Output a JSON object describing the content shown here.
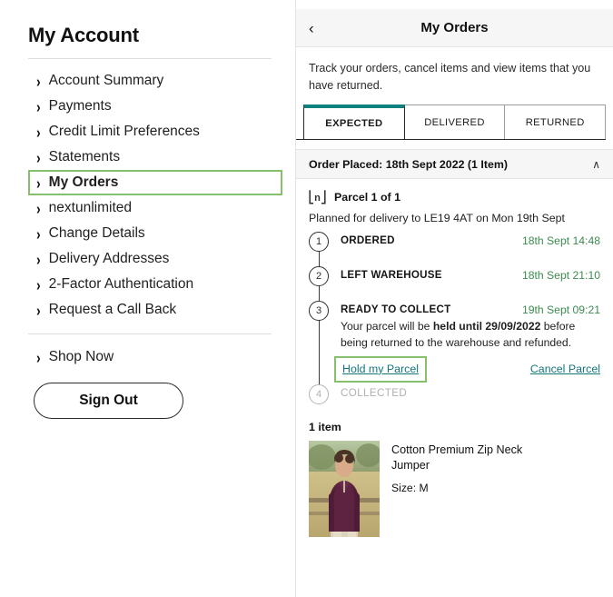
{
  "sidebar": {
    "title": "My Account",
    "items": [
      {
        "label": "Account Summary",
        "active": false
      },
      {
        "label": "Payments",
        "active": false
      },
      {
        "label": "Credit Limit Preferences",
        "active": false
      },
      {
        "label": "Statements",
        "active": false
      },
      {
        "label": "My Orders",
        "active": true
      },
      {
        "label": "nextunlimited",
        "active": false
      },
      {
        "label": "Change Details",
        "active": false
      },
      {
        "label": "Delivery Addresses",
        "active": false
      },
      {
        "label": "2-Factor Authentication",
        "active": false
      },
      {
        "label": "Request a Call Back",
        "active": false
      }
    ],
    "shop_now": "Shop Now",
    "sign_out": "Sign Out",
    "chevron": "›"
  },
  "panel": {
    "back_icon": "‹",
    "title": "My Orders",
    "intro": "Track your orders, cancel items and view items that you have returned.",
    "tabs": [
      {
        "label": "EXPECTED",
        "active": true
      },
      {
        "label": "DELIVERED",
        "active": false
      },
      {
        "label": "RETURNED",
        "active": false
      }
    ],
    "order_bar": {
      "label": "Order Placed: 18th Sept 2022 (1 Item)",
      "caret": "∧"
    },
    "parcel": {
      "logo_letter": "n",
      "label": "Parcel 1 of 1",
      "planned": "Planned for delivery to LE19 4AT on Mon 19th Sept"
    },
    "timeline": [
      {
        "num": "1",
        "name": "ORDERED",
        "date": "18th Sept 14:48",
        "muted": false
      },
      {
        "num": "2",
        "name": "LEFT WAREHOUSE",
        "date": "18th Sept 21:10",
        "muted": false
      },
      {
        "num": "3",
        "name": "READY TO COLLECT",
        "date": "19th Sept 09:21",
        "muted": false
      },
      {
        "num": "4",
        "name": "COLLECTED",
        "date": "",
        "muted": true
      }
    ],
    "note": {
      "prefix": "Your parcel will be ",
      "bold": "held until 29/09/2022",
      "suffix": " before being returned to the warehouse and refunded."
    },
    "actions": {
      "hold": "Hold my Parcel",
      "cancel": "Cancel Parcel"
    },
    "items_count": "1 item",
    "item": {
      "name": "Cotton Premium Zip Neck Jumper",
      "size": "Size: M"
    }
  },
  "colors": {
    "accent_teal": "#0d8080",
    "link_teal": "#13767a",
    "date_green": "#3d8b50",
    "highlight_green": "#86c06a"
  }
}
